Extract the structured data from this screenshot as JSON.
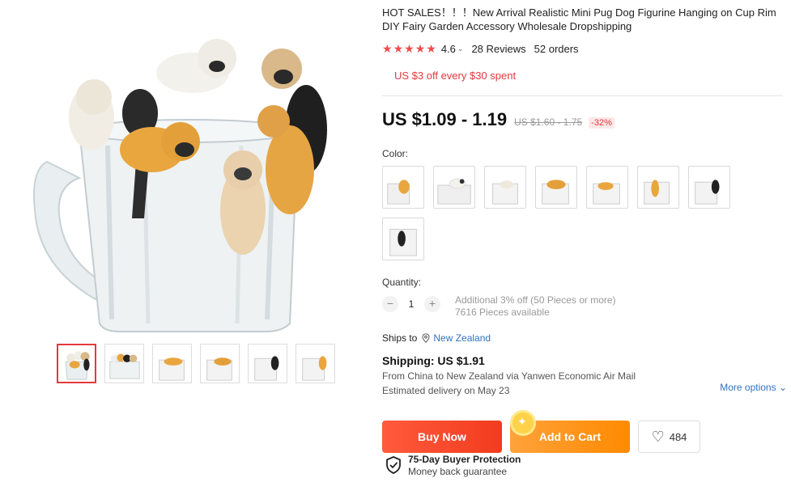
{
  "product": {
    "title": "HOT SALES！！！New Arrival Realistic Mini Pug Dog Figurine Hanging on Cup Rim DIY Fairy Garden Accessory Wholesale Dropshipping",
    "rating": "4.6",
    "reviews": "28 Reviews",
    "orders": "52 orders",
    "coupon": "US $3 off every $30 spent",
    "price": "US $1.09 - 1.19",
    "original_price": "US $1.60 - 1.75",
    "discount": "-32%"
  },
  "color": {
    "label": "Color:",
    "swatch_count": 8
  },
  "quantity": {
    "label": "Quantity:",
    "value": "1",
    "minus": "−",
    "plus": "+",
    "bulk_note": "Additional 3% off (50 Pieces or more)",
    "available": "7616 Pieces available"
  },
  "shipping": {
    "ships_to_label": "Ships to",
    "destination": "New Zealand",
    "title": "Shipping: US $1.91",
    "route": "From China to New Zealand via Yanwen Economic Air Mail",
    "delivery": "Estimated delivery on May 23",
    "more_options": "More options"
  },
  "actions": {
    "buy_now": "Buy Now",
    "add_to_cart": "Add to Cart",
    "wishlist_count": "484"
  },
  "protection": {
    "title": "75-Day Buyer Protection",
    "subtitle": "Money back guarantee"
  },
  "colors": {
    "accent_red": "#e4393c",
    "buy_orange_red": "#f23c1e",
    "cart_orange": "#ff8a00",
    "link_blue": "#2f73c2",
    "star_red": "#f14b4b"
  },
  "icons": [
    "location-pin-icon",
    "heart-icon",
    "shield-check-icon",
    "chevron-down-icon",
    "sparkle-icon"
  ]
}
